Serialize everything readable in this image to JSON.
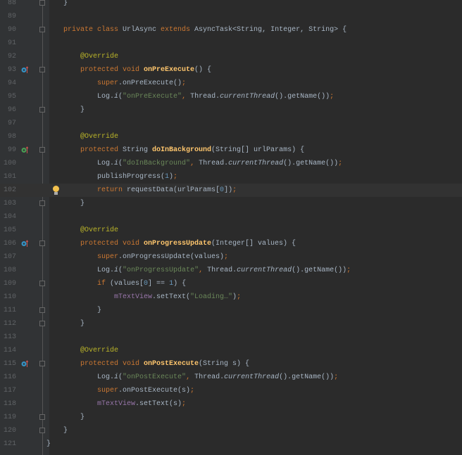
{
  "editor": {
    "current_line": 102,
    "lines": [
      {
        "n": "88",
        "indent": 1,
        "fold": true,
        "t": [
          [
            "p",
            "}"
          ]
        ]
      },
      {
        "n": "89",
        "indent": 0,
        "t": []
      },
      {
        "n": "90",
        "indent": 1,
        "fold": true,
        "t": [
          [
            "kw",
            "private class "
          ],
          [
            "p",
            "UrlAsync "
          ],
          [
            "kw",
            "extends "
          ],
          [
            "p",
            "AsyncTask<String, Integer, String> {"
          ]
        ]
      },
      {
        "n": "91",
        "indent": 0,
        "t": []
      },
      {
        "n": "92",
        "indent": 2,
        "t": [
          [
            "ann",
            "@Override"
          ]
        ]
      },
      {
        "n": "93",
        "indent": 2,
        "fold": true,
        "icon": "override-icon",
        "t": [
          [
            "kw",
            "protected void "
          ],
          [
            "fn",
            "onPreExecute"
          ],
          [
            "p",
            "() {"
          ]
        ]
      },
      {
        "n": "94",
        "indent": 3,
        "t": [
          [
            "kw",
            "super"
          ],
          [
            "p",
            ".onPreExecute()"
          ],
          [
            "kw",
            ";"
          ]
        ]
      },
      {
        "n": "95",
        "indent": 3,
        "t": [
          [
            "p",
            "Log."
          ],
          [
            "it",
            "i"
          ],
          [
            "p",
            "("
          ],
          [
            "str",
            "\"onPreExecute\""
          ],
          [
            "kw",
            ", "
          ],
          [
            "p",
            "Thread."
          ],
          [
            "it",
            "currentThread"
          ],
          [
            "p",
            "().getName())"
          ],
          [
            "kw",
            ";"
          ]
        ]
      },
      {
        "n": "96",
        "indent": 2,
        "fold": true,
        "t": [
          [
            "p",
            "}"
          ]
        ]
      },
      {
        "n": "97",
        "indent": 0,
        "t": []
      },
      {
        "n": "98",
        "indent": 2,
        "t": [
          [
            "ann",
            "@Override"
          ]
        ]
      },
      {
        "n": "99",
        "indent": 2,
        "fold": true,
        "icon": "implement-icon",
        "t": [
          [
            "kw",
            "protected "
          ],
          [
            "p",
            "String "
          ],
          [
            "fn",
            "doInBackground"
          ],
          [
            "p",
            "(String[] urlParams) {"
          ]
        ]
      },
      {
        "n": "100",
        "indent": 3,
        "t": [
          [
            "p",
            "Log."
          ],
          [
            "it",
            "i"
          ],
          [
            "p",
            "("
          ],
          [
            "str",
            "\"doInBackground\""
          ],
          [
            "kw",
            ", "
          ],
          [
            "p",
            "Thread."
          ],
          [
            "it",
            "currentThread"
          ],
          [
            "p",
            "().getName())"
          ],
          [
            "kw",
            ";"
          ]
        ]
      },
      {
        "n": "101",
        "indent": 3,
        "t": [
          [
            "p",
            "publishProgress("
          ],
          [
            "num",
            "1"
          ],
          [
            "p",
            ")"
          ],
          [
            "kw",
            ";"
          ]
        ]
      },
      {
        "n": "102",
        "indent": 3,
        "bulb": true,
        "t": [
          [
            "kw",
            "return "
          ],
          [
            "p",
            "requestData(urlParams["
          ],
          [
            "num",
            "0"
          ],
          [
            "p",
            "])"
          ],
          [
            "kw",
            ";"
          ]
        ]
      },
      {
        "n": "103",
        "indent": 2,
        "fold": true,
        "t": [
          [
            "p",
            "}"
          ]
        ]
      },
      {
        "n": "104",
        "indent": 0,
        "t": []
      },
      {
        "n": "105",
        "indent": 2,
        "t": [
          [
            "ann",
            "@Override"
          ]
        ]
      },
      {
        "n": "106",
        "indent": 2,
        "fold": true,
        "icon": "override-icon",
        "t": [
          [
            "kw",
            "protected void "
          ],
          [
            "fn",
            "onProgressUpdate"
          ],
          [
            "p",
            "(Integer[] values) {"
          ]
        ]
      },
      {
        "n": "107",
        "indent": 3,
        "t": [
          [
            "kw",
            "super"
          ],
          [
            "p",
            ".onProgressUpdate(values)"
          ],
          [
            "kw",
            ";"
          ]
        ]
      },
      {
        "n": "108",
        "indent": 3,
        "t": [
          [
            "p",
            "Log."
          ],
          [
            "it",
            "i"
          ],
          [
            "p",
            "("
          ],
          [
            "str",
            "\"onProgressUpdate\""
          ],
          [
            "kw",
            ", "
          ],
          [
            "p",
            "Thread."
          ],
          [
            "it",
            "currentThread"
          ],
          [
            "p",
            "().getName())"
          ],
          [
            "kw",
            ";"
          ]
        ]
      },
      {
        "n": "109",
        "indent": 3,
        "fold": true,
        "t": [
          [
            "kw",
            "if "
          ],
          [
            "p",
            "(values["
          ],
          [
            "num",
            "0"
          ],
          [
            "p",
            "] == "
          ],
          [
            "num",
            "1"
          ],
          [
            "p",
            ") {"
          ]
        ]
      },
      {
        "n": "110",
        "indent": 4,
        "t": [
          [
            "field",
            "mTextView"
          ],
          [
            "p",
            ".setText("
          ],
          [
            "str",
            "\"Loading…\""
          ],
          [
            "p",
            ")"
          ],
          [
            "kw",
            ";"
          ]
        ]
      },
      {
        "n": "111",
        "indent": 3,
        "fold": true,
        "t": [
          [
            "p",
            "}"
          ]
        ]
      },
      {
        "n": "112",
        "indent": 2,
        "fold": true,
        "t": [
          [
            "p",
            "}"
          ]
        ]
      },
      {
        "n": "113",
        "indent": 0,
        "t": []
      },
      {
        "n": "114",
        "indent": 2,
        "t": [
          [
            "ann",
            "@Override"
          ]
        ]
      },
      {
        "n": "115",
        "indent": 2,
        "fold": true,
        "icon": "override-icon",
        "t": [
          [
            "kw",
            "protected void "
          ],
          [
            "fn",
            "onPostExecute"
          ],
          [
            "p",
            "(String s) {"
          ]
        ]
      },
      {
        "n": "116",
        "indent": 3,
        "t": [
          [
            "p",
            "Log."
          ],
          [
            "it",
            "i"
          ],
          [
            "p",
            "("
          ],
          [
            "str",
            "\"onPostExecute\""
          ],
          [
            "kw",
            ", "
          ],
          [
            "p",
            "Thread."
          ],
          [
            "it",
            "currentThread"
          ],
          [
            "p",
            "().getName())"
          ],
          [
            "kw",
            ";"
          ]
        ]
      },
      {
        "n": "117",
        "indent": 3,
        "t": [
          [
            "kw",
            "super"
          ],
          [
            "p",
            ".onPostExecute(s)"
          ],
          [
            "kw",
            ";"
          ]
        ]
      },
      {
        "n": "118",
        "indent": 3,
        "t": [
          [
            "field",
            "mTextView"
          ],
          [
            "p",
            ".setText(s)"
          ],
          [
            "kw",
            ";"
          ]
        ]
      },
      {
        "n": "119",
        "indent": 2,
        "fold": true,
        "t": [
          [
            "p",
            "}"
          ]
        ]
      },
      {
        "n": "120",
        "indent": 1,
        "fold": true,
        "t": [
          [
            "p",
            "}"
          ]
        ]
      },
      {
        "n": "121",
        "indent": 0,
        "t": [
          [
            "p",
            "}"
          ]
        ]
      }
    ]
  }
}
